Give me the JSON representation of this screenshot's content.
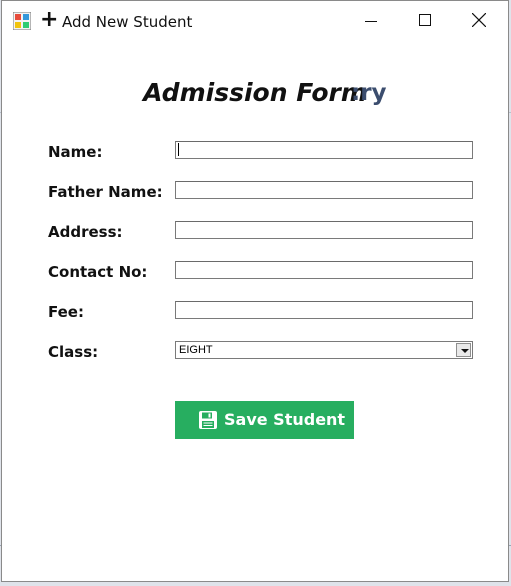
{
  "window": {
    "title": "Add New Student"
  },
  "form": {
    "heading": "Admission Form",
    "heading_overlap": ":ry"
  },
  "fields": {
    "name_label": "Name:",
    "father_name_label": "Father Name:",
    "address_label": "Address:",
    "contact_label": "Contact No:",
    "fee_label": "Fee:",
    "class_label": "Class:",
    "name_value": "",
    "father_name_value": "",
    "address_value": "",
    "contact_value": "",
    "fee_value": "",
    "class_value": "EIGHT"
  },
  "actions": {
    "save_label": "Save Student"
  },
  "colors": {
    "save_button_bg": "#27ae60",
    "heading_overlap": "#3b4d6e"
  },
  "icons": {
    "app": "app-icon",
    "add": "plus-icon",
    "save": "floppy-disk-icon"
  }
}
